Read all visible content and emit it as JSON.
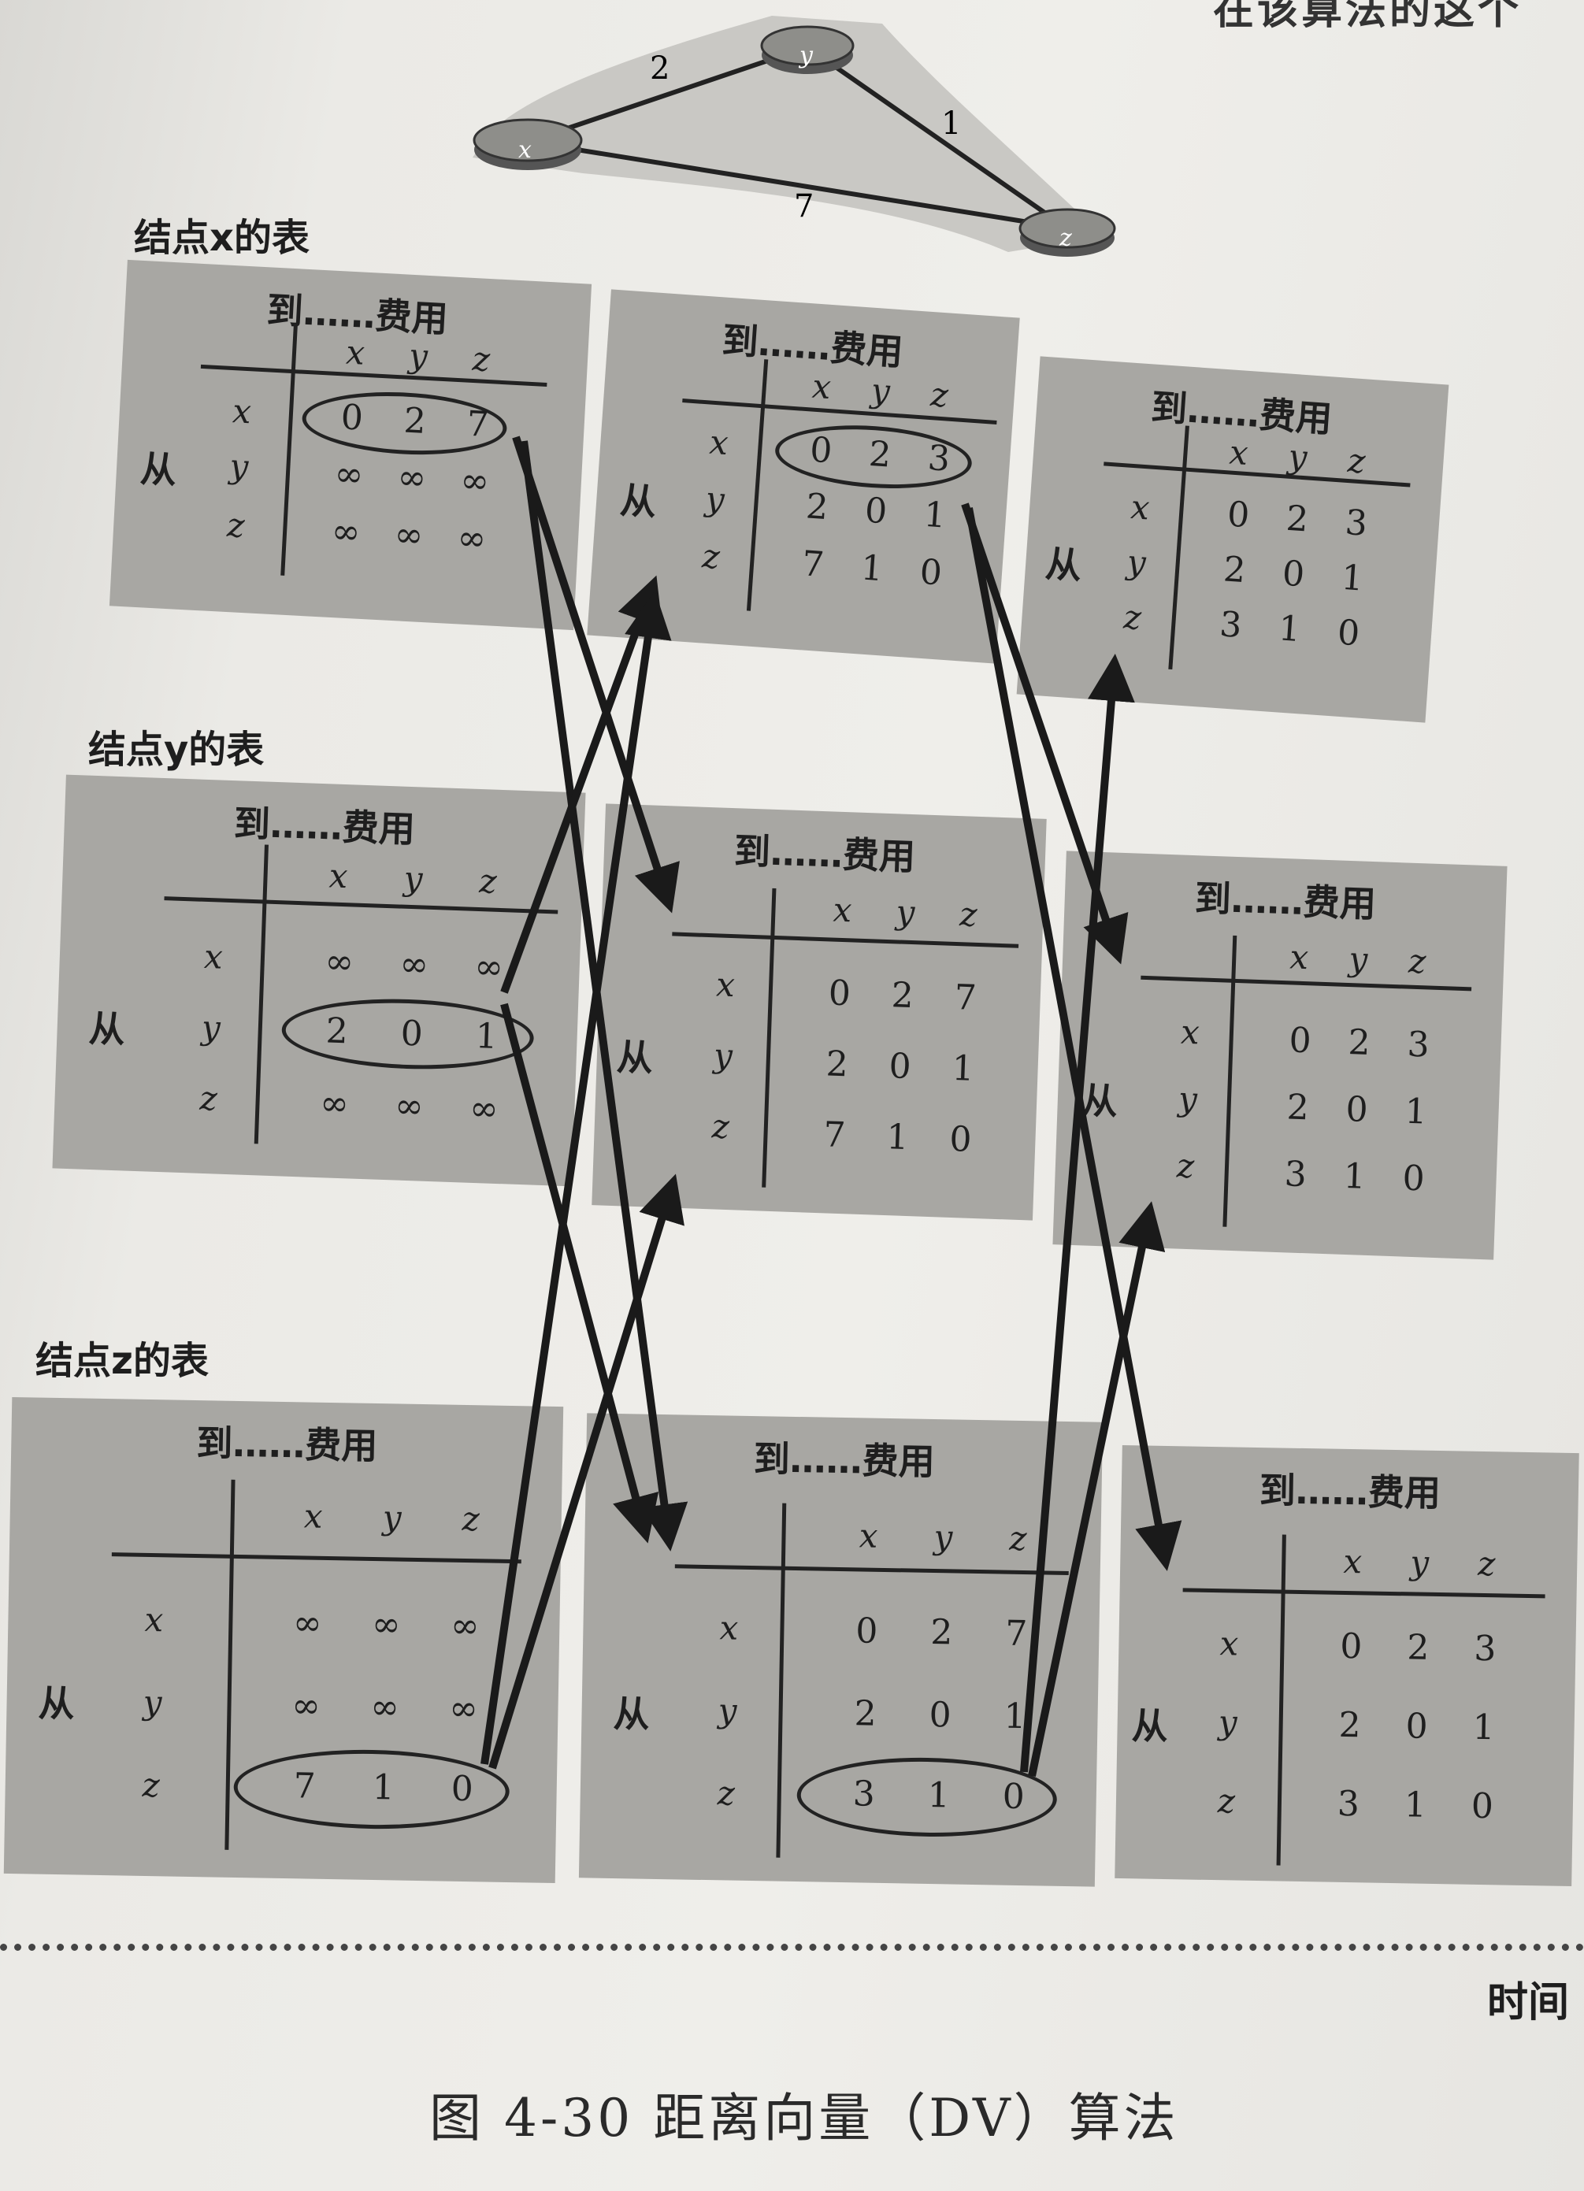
{
  "corner_text": "在该算法的这个",
  "network": {
    "nodes": [
      "x",
      "y",
      "z"
    ],
    "links": [
      {
        "from": "x",
        "to": "y",
        "cost": "2"
      },
      {
        "from": "y",
        "to": "z",
        "cost": "1"
      },
      {
        "from": "x",
        "to": "z",
        "cost": "7"
      }
    ]
  },
  "node_labels": [
    "结点x的表",
    "结点y的表",
    "结点z的表"
  ],
  "table_title": "到……费用",
  "from_label": "从",
  "headers": [
    "x",
    "y",
    "z"
  ],
  "tables": [
    {
      "node": "x",
      "rows": [
        [
          "0",
          "2",
          "7"
        ],
        [
          "∞",
          "∞",
          "∞"
        ],
        [
          "∞",
          "∞",
          "∞"
        ]
      ]
    },
    {
      "node": "x",
      "rows": [
        [
          "0",
          "2",
          "3"
        ],
        [
          "2",
          "0",
          "1"
        ],
        [
          "7",
          "1",
          "0"
        ]
      ]
    },
    {
      "node": "x",
      "rows": [
        [
          "0",
          "2",
          "3"
        ],
        [
          "2",
          "0",
          "1"
        ],
        [
          "3",
          "1",
          "0"
        ]
      ]
    },
    {
      "node": "y",
      "rows": [
        [
          "∞",
          "∞",
          "∞"
        ],
        [
          "2",
          "0",
          "1"
        ],
        [
          "∞",
          "∞",
          "∞"
        ]
      ]
    },
    {
      "node": "y",
      "rows": [
        [
          "0",
          "2",
          "7"
        ],
        [
          "2",
          "0",
          "1"
        ],
        [
          "7",
          "1",
          "0"
        ]
      ]
    },
    {
      "node": "y",
      "rows": [
        [
          "0",
          "2",
          "3"
        ],
        [
          "2",
          "0",
          "1"
        ],
        [
          "3",
          "1",
          "0"
        ]
      ]
    },
    {
      "node": "z",
      "rows": [
        [
          "∞",
          "∞",
          "∞"
        ],
        [
          "∞",
          "∞",
          "∞"
        ],
        [
          "7",
          "1",
          "0"
        ]
      ]
    },
    {
      "node": "z",
      "rows": [
        [
          "0",
          "2",
          "7"
        ],
        [
          "2",
          "0",
          "1"
        ],
        [
          "3",
          "1",
          "0"
        ]
      ]
    },
    {
      "node": "z",
      "rows": [
        [
          "0",
          "2",
          "3"
        ],
        [
          "2",
          "0",
          "1"
        ],
        [
          "3",
          "1",
          "0"
        ]
      ]
    }
  ],
  "time_label": "时间",
  "caption": "图 4-30  距离向量（DV）算法"
}
